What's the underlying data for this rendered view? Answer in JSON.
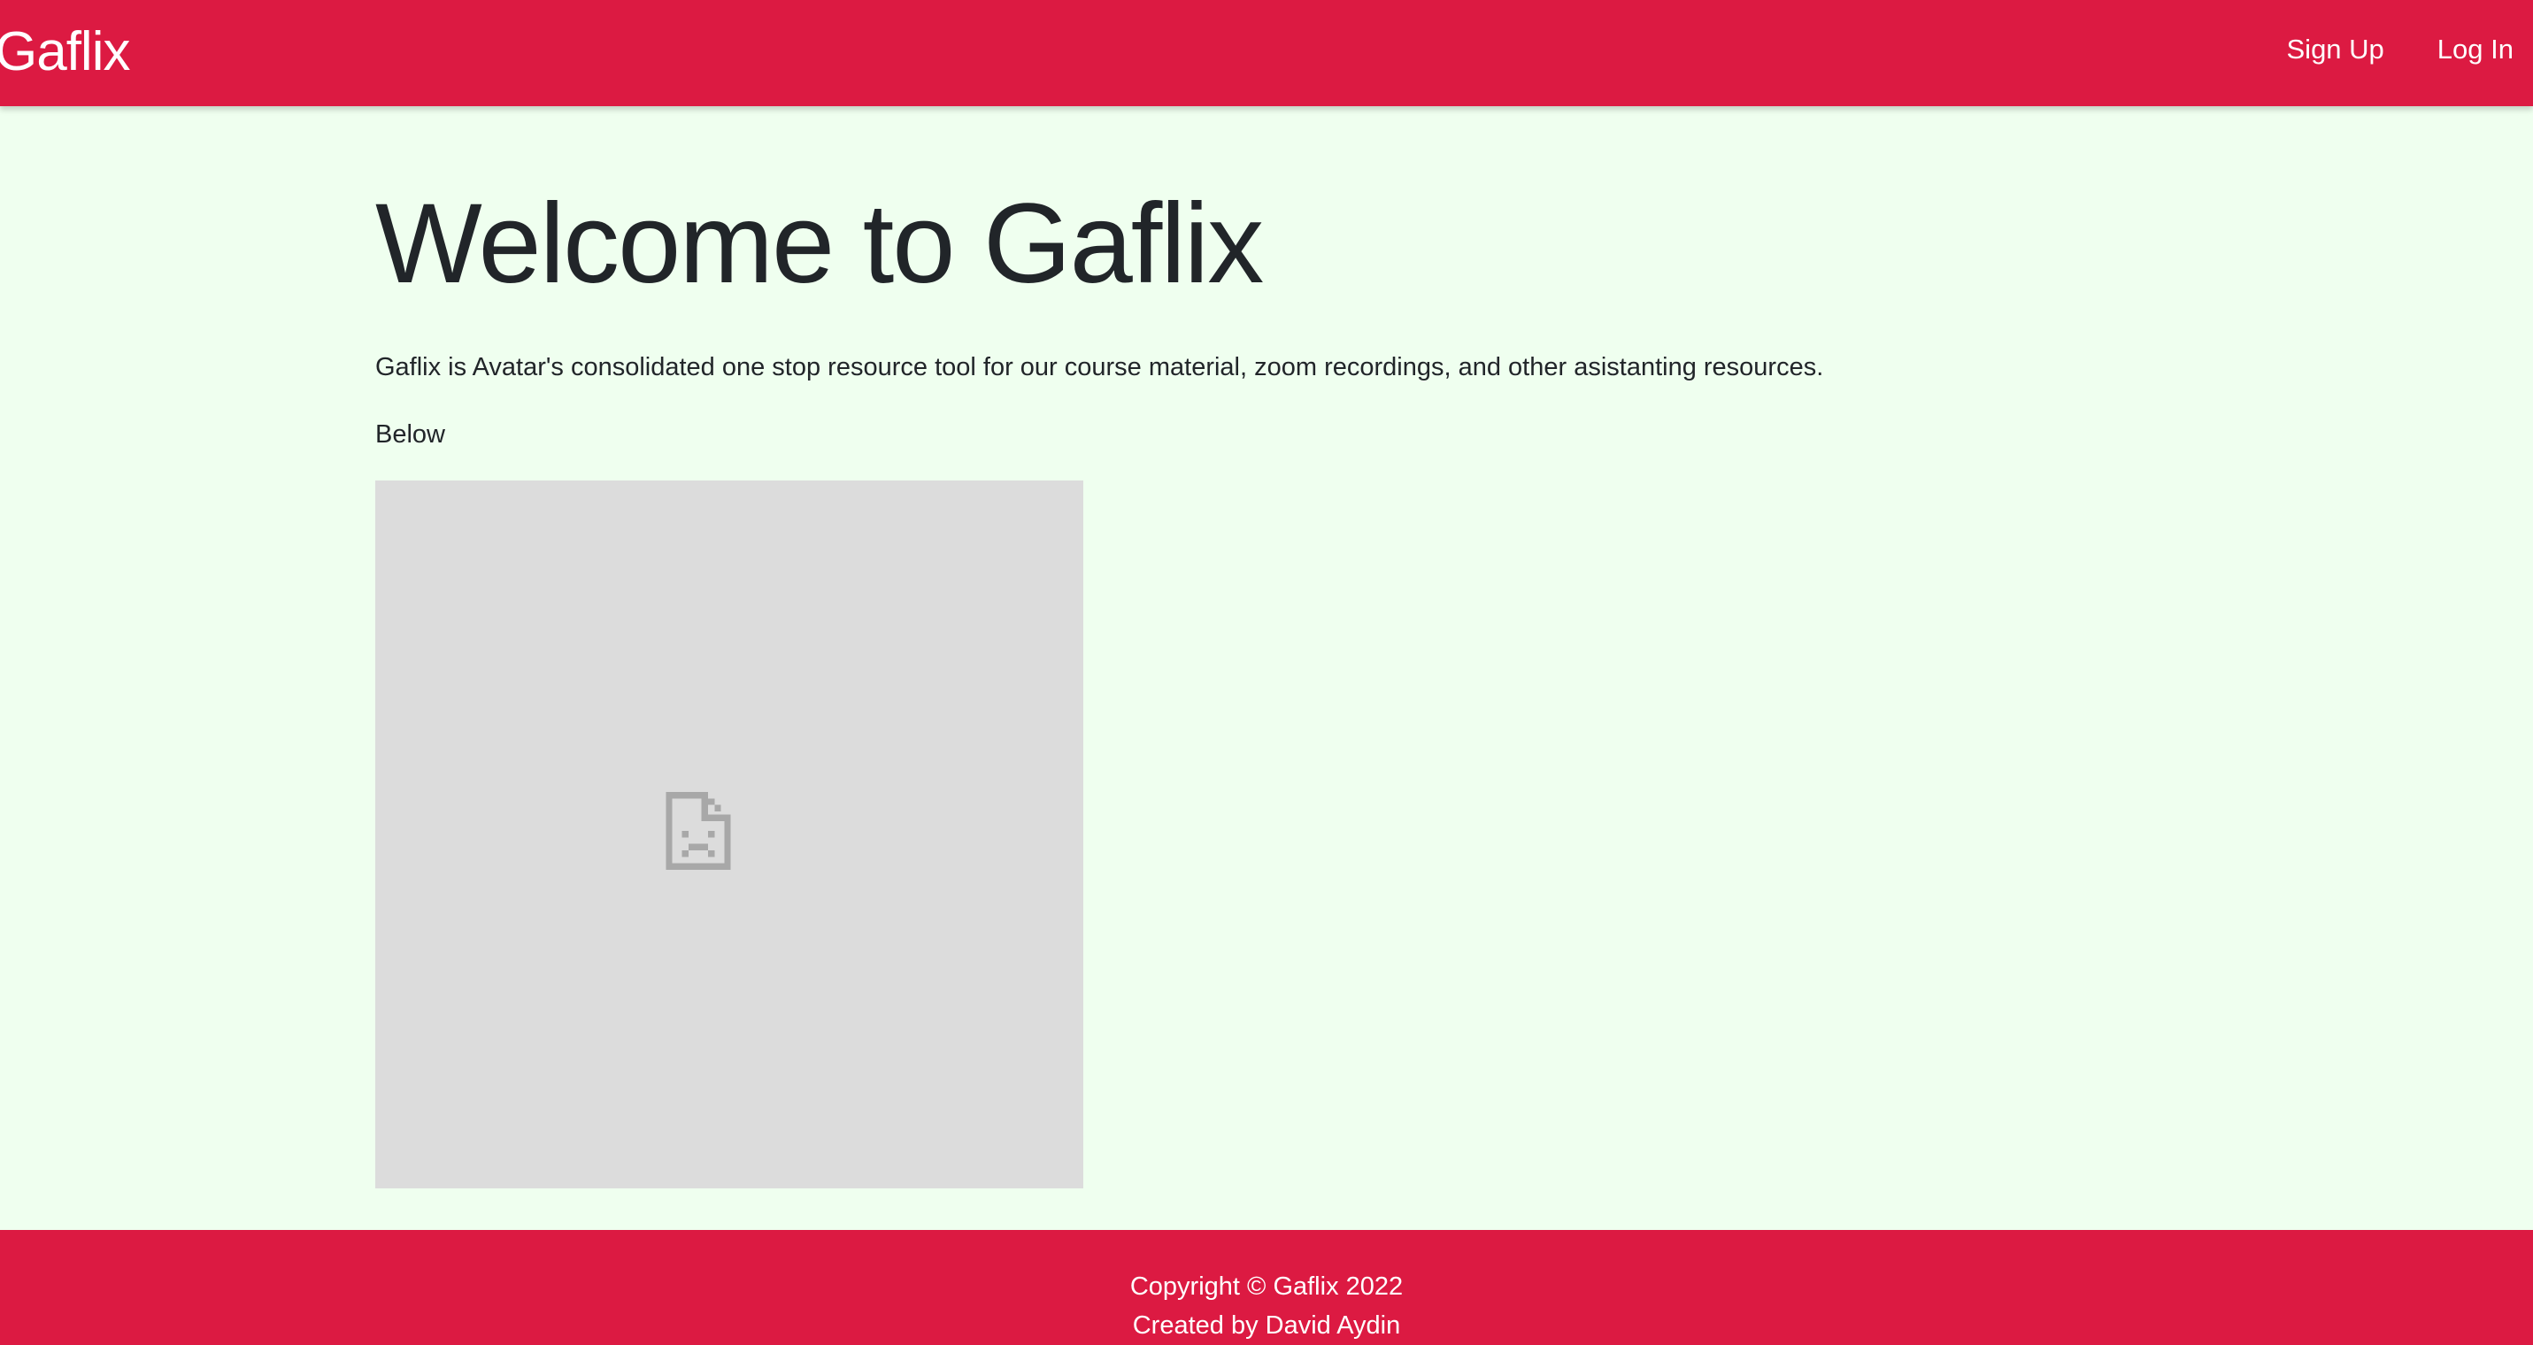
{
  "navbar": {
    "brand": "Gaflix",
    "links": [
      {
        "label": "Sign Up"
      },
      {
        "label": "Log In"
      }
    ],
    "background_color": "#dc1a42"
  },
  "main": {
    "title": "Welcome to Gaflix",
    "intro": "Gaflix is Avatar's consolidated one stop resource tool for our course material, zoom recordings, and other asistanting resources.",
    "below_label": "Below",
    "image": {
      "state": "broken",
      "icon": "broken-image-icon"
    }
  },
  "footer": {
    "copyright": "Copyright © Gaflix 2022",
    "credit": "Created by David Aydin"
  },
  "colors": {
    "accent": "#dc1a42",
    "page_background": "#efffef",
    "placeholder": "#dcdcdc"
  }
}
